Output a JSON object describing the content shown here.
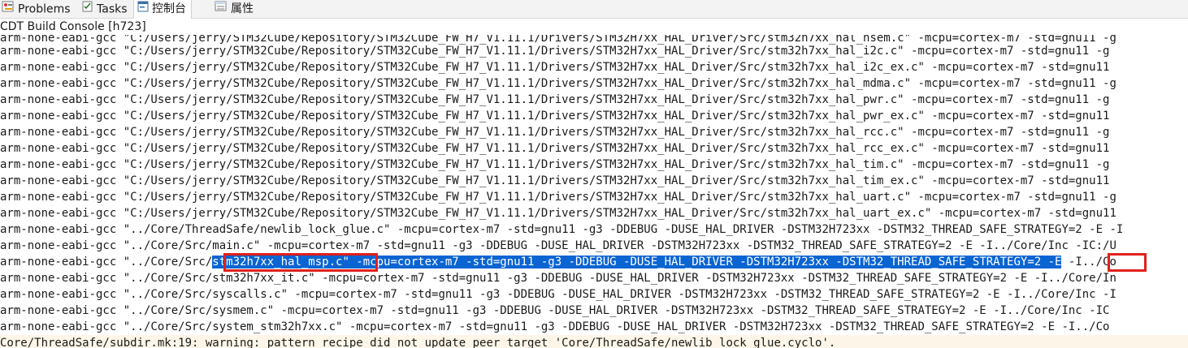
{
  "tabs": [
    {
      "label": "Problems",
      "icon": "problems-icon"
    },
    {
      "label": "Tasks",
      "icon": "tasks-icon"
    },
    {
      "label": "控制台",
      "icon": "console-icon"
    },
    {
      "label": "属性",
      "icon": "properties-icon"
    }
  ],
  "console_title": "CDT Build Console [h723]",
  "lines": [
    "arm-none-eabi-gcc \"C:/Users/jerry/STM32Cube/Repository/STM32Cube_FW_H7_V1.11.1/Drivers/STM32H7xx_HAL_Driver/Src/stm32h7xx_hal_hsem.c\" -mcpu=cortex-m7 -std=gnu11 -g",
    "arm-none-eabi-gcc \"C:/Users/jerry/STM32Cube/Repository/STM32Cube_FW_H7_V1.11.1/Drivers/STM32H7xx_HAL_Driver/Src/stm32h7xx_hal_i2c.c\" -mcpu=cortex-m7 -std=gnu11 -g",
    "arm-none-eabi-gcc \"C:/Users/jerry/STM32Cube/Repository/STM32Cube_FW_H7_V1.11.1/Drivers/STM32H7xx_HAL_Driver/Src/stm32h7xx_hal_i2c_ex.c\" -mcpu=cortex-m7 -std=gnu11",
    "arm-none-eabi-gcc \"C:/Users/jerry/STM32Cube/Repository/STM32Cube_FW_H7_V1.11.1/Drivers/STM32H7xx_HAL_Driver/Src/stm32h7xx_hal_mdma.c\" -mcpu=cortex-m7 -std=gnu11 -g",
    "arm-none-eabi-gcc \"C:/Users/jerry/STM32Cube/Repository/STM32Cube_FW_H7_V1.11.1/Drivers/STM32H7xx_HAL_Driver/Src/stm32h7xx_hal_pwr.c\" -mcpu=cortex-m7 -std=gnu11 -g",
    "arm-none-eabi-gcc \"C:/Users/jerry/STM32Cube/Repository/STM32Cube_FW_H7_V1.11.1/Drivers/STM32H7xx_HAL_Driver/Src/stm32h7xx_hal_pwr_ex.c\" -mcpu=cortex-m7 -std=gnu11",
    "arm-none-eabi-gcc \"C:/Users/jerry/STM32Cube/Repository/STM32Cube_FW_H7_V1.11.1/Drivers/STM32H7xx_HAL_Driver/Src/stm32h7xx_hal_rcc.c\" -mcpu=cortex-m7 -std=gnu11 -g",
    "arm-none-eabi-gcc \"C:/Users/jerry/STM32Cube/Repository/STM32Cube_FW_H7_V1.11.1/Drivers/STM32H7xx_HAL_Driver/Src/stm32h7xx_hal_rcc_ex.c\" -mcpu=cortex-m7 -std=gnu11",
    "arm-none-eabi-gcc \"C:/Users/jerry/STM32Cube/Repository/STM32Cube_FW_H7_V1.11.1/Drivers/STM32H7xx_HAL_Driver/Src/stm32h7xx_hal_tim.c\" -mcpu=cortex-m7 -std=gnu11 -g",
    "arm-none-eabi-gcc \"C:/Users/jerry/STM32Cube/Repository/STM32Cube_FW_H7_V1.11.1/Drivers/STM32H7xx_HAL_Driver/Src/stm32h7xx_hal_tim_ex.c\" -mcpu=cortex-m7 -std=gnu11",
    "arm-none-eabi-gcc \"C:/Users/jerry/STM32Cube/Repository/STM32Cube_FW_H7_V1.11.1/Drivers/STM32H7xx_HAL_Driver/Src/stm32h7xx_hal_uart.c\" -mcpu=cortex-m7 -std=gnu11 -g",
    "arm-none-eabi-gcc \"C:/Users/jerry/STM32Cube/Repository/STM32Cube_FW_H7_V1.11.1/Drivers/STM32H7xx_HAL_Driver/Src/stm32h7xx_hal_uart_ex.c\" -mcpu=cortex-m7 -std=gnu11",
    "arm-none-eabi-gcc \"../Core/ThreadSafe/newlib_lock_glue.c\" -mcpu=cortex-m7 -std=gnu11 -g3 -DDEBUG -DUSE_HAL_DRIVER -DSTM32H723xx -DSTM32_THREAD_SAFE_STRATEGY=2 -E -I",
    "arm-none-eabi-gcc \"../Core/Src/main.c\" -mcpu=cortex-m7 -std=gnu11 -g3 -DDEBUG -DUSE_HAL_DRIVER -DSTM32H723xx -DSTM32_THREAD_SAFE_STRATEGY=2 -E -I../Core/Inc -IC:/U",
    {
      "pre": "arm-none-eabi-gcc \"../Core/Src/",
      "selected": "stm32h7xx_hal_msp.c\" -mcpu=cortex-m7 -std=gnu11 -g3 -DDEBUG -DUSE_HAL_DRIVER -DSTM32H723xx -DSTM32_THREAD_SAFE_STRATEGY=2 -E",
      "post": " -I../Co"
    },
    "arm-none-eabi-gcc \"../Core/Src/stm32h7xx_it.c\" -mcpu=cortex-m7 -std=gnu11 -g3 -DDEBUG -DUSE_HAL_DRIVER -DSTM32H723xx -DSTM32_THREAD_SAFE_STRATEGY=2 -E -I../Core/In",
    "arm-none-eabi-gcc \"../Core/Src/syscalls.c\" -mcpu=cortex-m7 -std=gnu11 -g3 -DDEBUG -DUSE_HAL_DRIVER -DSTM32H723xx -DSTM32_THREAD_SAFE_STRATEGY=2 -E -I../Core/Inc -I",
    "arm-none-eabi-gcc \"../Core/Src/sysmem.c\" -mcpu=cortex-m7 -std=gnu11 -g3 -DDEBUG -DUSE_HAL_DRIVER -DSTM32H723xx -DSTM32_THREAD_SAFE_STRATEGY=2 -E -I../Core/Inc -IC",
    "arm-none-eabi-gcc \"../Core/Src/system_stm32h7xx.c\" -mcpu=cortex-m7 -std=gnu11 -g3 -DDEBUG -DUSE_HAL_DRIVER -DSTM32H723xx -DSTM32_THREAD_SAFE_STRATEGY=2 -E -I../Co"
  ],
  "warning_line": "Core/ThreadSafe/subdir.mk:19: warning: pattern recipe did not update peer target 'Core/ThreadSafe/newlib_lock_glue.cyclo'.",
  "colors": {
    "selection": "#0a64d2",
    "highlight_box": "#e0201b",
    "warning_bg": "#fdf6e8"
  }
}
